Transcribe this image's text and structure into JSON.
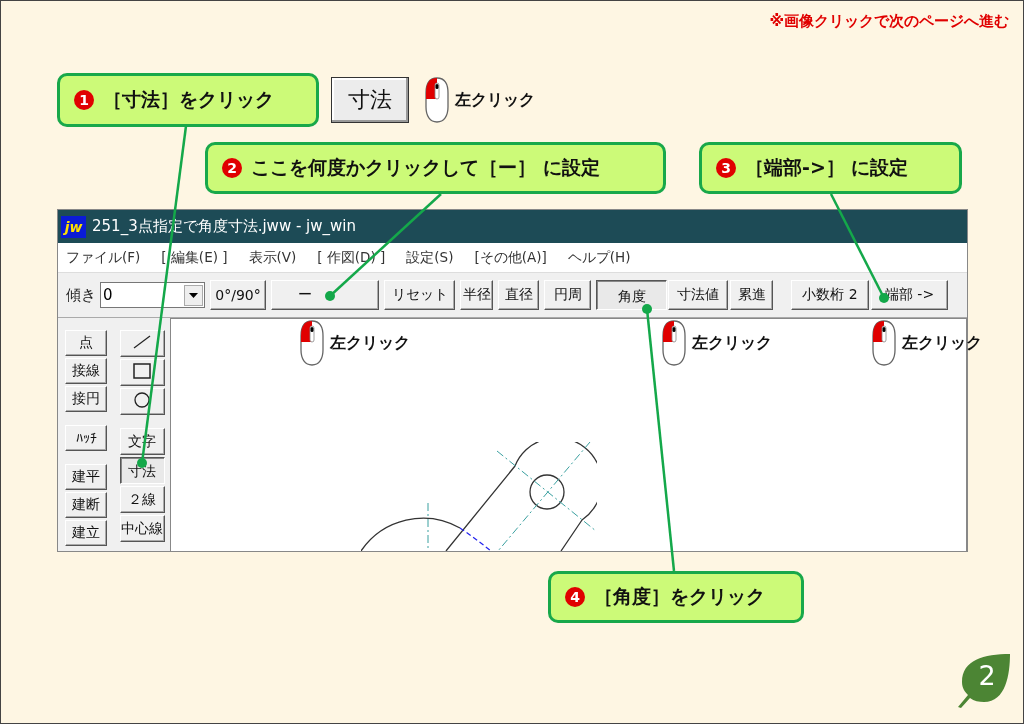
{
  "note": "※画像クリックで次のページへ進む",
  "steps": [
    {
      "number": "1",
      "text": "［寸法］をクリック"
    },
    {
      "number": "2",
      "text": "ここを何度かクリックして［ー］ に設定"
    },
    {
      "number": "3",
      "text": "［端部->］ に設定"
    },
    {
      "number": "4",
      "text": "［角度］をクリック"
    }
  ],
  "sample_button": {
    "label": "寸法"
  },
  "click_hints": [
    "左クリック",
    "左クリック",
    "左クリック",
    "左クリック"
  ],
  "window": {
    "app_icon": "jw",
    "title": "251_3点指定で角度寸法.jww - jw_win",
    "menu": [
      "ファイル(F)",
      "[ 編集(E) ]",
      "表示(V)",
      "[ 作図(D) ]",
      "設定(S)",
      "[その他(A)]",
      "ヘルプ(H)"
    ],
    "toolbar": {
      "label": "傾き",
      "field_value": "0",
      "buttons": [
        {
          "label": "0°/90°",
          "selected": false
        },
        {
          "label": "ー",
          "selected": false
        },
        {
          "label": "リセット",
          "selected": false
        },
        {
          "label": "半径",
          "selected": false
        },
        {
          "label": "直径",
          "selected": false
        },
        {
          "label": "円周",
          "selected": false
        },
        {
          "label": "角度",
          "selected": true
        },
        {
          "label": "寸法値",
          "selected": false
        },
        {
          "label": "累進",
          "selected": false
        },
        {
          "label": "小数桁 2",
          "selected": false
        },
        {
          "label": "端部 ->",
          "selected": false
        }
      ]
    },
    "tools_left": [
      {
        "label": "点",
        "selected": false
      },
      {
        "label": "接線",
        "selected": false
      },
      {
        "label": "接円",
        "selected": false
      },
      {
        "label": "ﾊｯﾁ",
        "selected": false
      },
      {
        "label": "建平",
        "selected": false
      },
      {
        "label": "建断",
        "selected": false
      },
      {
        "label": "建立",
        "selected": false
      }
    ],
    "tools_right": [
      {
        "kind": "icon",
        "selected": false
      },
      {
        "kind": "icon",
        "selected": false
      },
      {
        "kind": "icon",
        "selected": false
      },
      {
        "kind": "text",
        "label": "文字",
        "selected": false
      },
      {
        "kind": "text",
        "label": "寸法",
        "selected": true
      },
      {
        "kind": "text",
        "label": "２線",
        "selected": false
      },
      {
        "kind": "text",
        "label": "中心線",
        "selected": false
      }
    ]
  },
  "page_number": "2"
}
